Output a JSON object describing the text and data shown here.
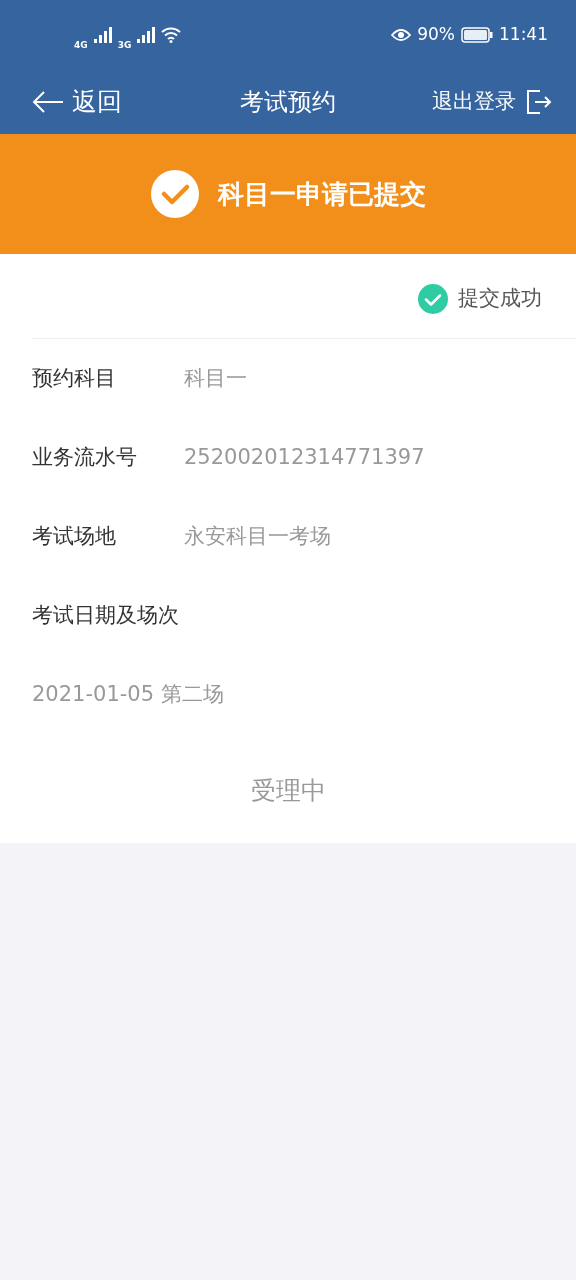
{
  "status_bar": {
    "network_1": "4G",
    "network_2": "3G",
    "battery": "90%",
    "time": "11:41"
  },
  "nav": {
    "back": "返回",
    "title": "考试预约",
    "logout": "退出登录"
  },
  "banner": {
    "message": "科目一申请已提交"
  },
  "result": {
    "status": "提交成功"
  },
  "fields": [
    {
      "kind": "inline",
      "label": "预约科目",
      "value": "科目一"
    },
    {
      "kind": "inline",
      "label": "业务流水号",
      "value": "252002012314771397"
    },
    {
      "kind": "inline",
      "label": "考试场地",
      "value": "永安科目一考场"
    },
    {
      "kind": "stacked",
      "label": "考试日期及场次",
      "value": "2021-01-05 第二场"
    }
  ],
  "footer_status": "受理中"
}
